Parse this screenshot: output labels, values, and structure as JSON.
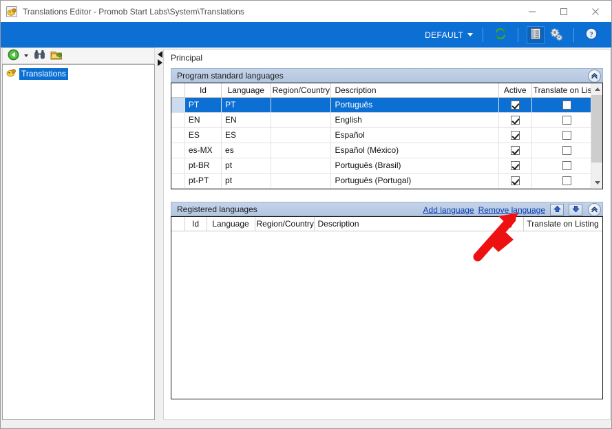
{
  "window": {
    "title": "Translations Editor - Promob Start Labs\\System\\Translations",
    "app_icon": "translations-app-icon",
    "controls": {
      "minimize": "minimize-icon",
      "maximize": "maximize-icon",
      "close": "close-icon"
    }
  },
  "ribbon": {
    "default_label": "DEFAULT",
    "dropdown_icon": "chevron-down-icon",
    "buttons": [
      {
        "name": "refresh-button",
        "icon": "refresh-icon"
      },
      {
        "name": "list-view-button",
        "icon": "list-view-icon"
      },
      {
        "name": "settings-button",
        "icon": "gears-icon"
      },
      {
        "name": "help-button",
        "icon": "help-icon"
      }
    ],
    "background": "#0b6fd4"
  },
  "sidebar": {
    "toolbar": [
      {
        "name": "back-button",
        "icon": "back-arrow-icon"
      },
      {
        "name": "back-dropdown",
        "icon": "caret-down-icon"
      },
      {
        "name": "find-button",
        "icon": "binoculars-icon"
      },
      {
        "name": "export-button",
        "icon": "folder-export-icon"
      }
    ],
    "tree": [
      {
        "label": "Translations",
        "icon": "translations-node-icon",
        "selected": true
      }
    ]
  },
  "splitter": {
    "collapse_left_icon": "triangle-left-icon",
    "expand_right_icon": "triangle-right-icon"
  },
  "main": {
    "tab": "Principal",
    "panels": [
      {
        "id": "program-standard-languages",
        "title": "Program standard languages",
        "collapse_icon": "double-chevron-up-icon",
        "columns": [
          "",
          "Id",
          "Language",
          "Region/Country",
          "Description",
          "Active",
          "Translate on Listing"
        ],
        "rows": [
          {
            "id": "PT",
            "language": "PT",
            "region": "",
            "description": "Português",
            "active": true,
            "translate_on_listing": false,
            "selected": true
          },
          {
            "id": "EN",
            "language": "EN",
            "region": "",
            "description": "English",
            "active": true,
            "translate_on_listing": false,
            "selected": false
          },
          {
            "id": "ES",
            "language": "ES",
            "region": "",
            "description": "Español",
            "active": true,
            "translate_on_listing": false,
            "selected": false
          },
          {
            "id": "es-MX",
            "language": "es",
            "region": "",
            "description": "Español (México)",
            "active": true,
            "translate_on_listing": false,
            "selected": false
          },
          {
            "id": "pt-BR",
            "language": "pt",
            "region": "",
            "description": "Português (Brasil)",
            "active": true,
            "translate_on_listing": false,
            "selected": false
          },
          {
            "id": "pt-PT",
            "language": "pt",
            "region": "",
            "description": "Português (Portugal)",
            "active": true,
            "translate_on_listing": false,
            "selected": false
          }
        ],
        "scrollbar": {
          "up_icon": "scroll-up-icon",
          "down_icon": "scroll-down-icon"
        }
      },
      {
        "id": "registered-languages",
        "title": "Registered languages",
        "links": [
          {
            "name": "add-language-link",
            "label": "Add language"
          },
          {
            "name": "remove-language-link",
            "label": "Remove language"
          }
        ],
        "nav_buttons": [
          {
            "name": "move-up-button",
            "icon": "arrow-up-icon"
          },
          {
            "name": "move-down-button",
            "icon": "arrow-down-icon"
          }
        ],
        "collapse_icon": "double-chevron-up-icon",
        "columns": [
          "",
          "Id",
          "Language",
          "Region/Country",
          "Description",
          "Translate on Listing"
        ],
        "rows": []
      }
    ]
  },
  "annotation": {
    "type": "red-arrow",
    "color": "#ee1111",
    "points_to": "Remove language"
  }
}
